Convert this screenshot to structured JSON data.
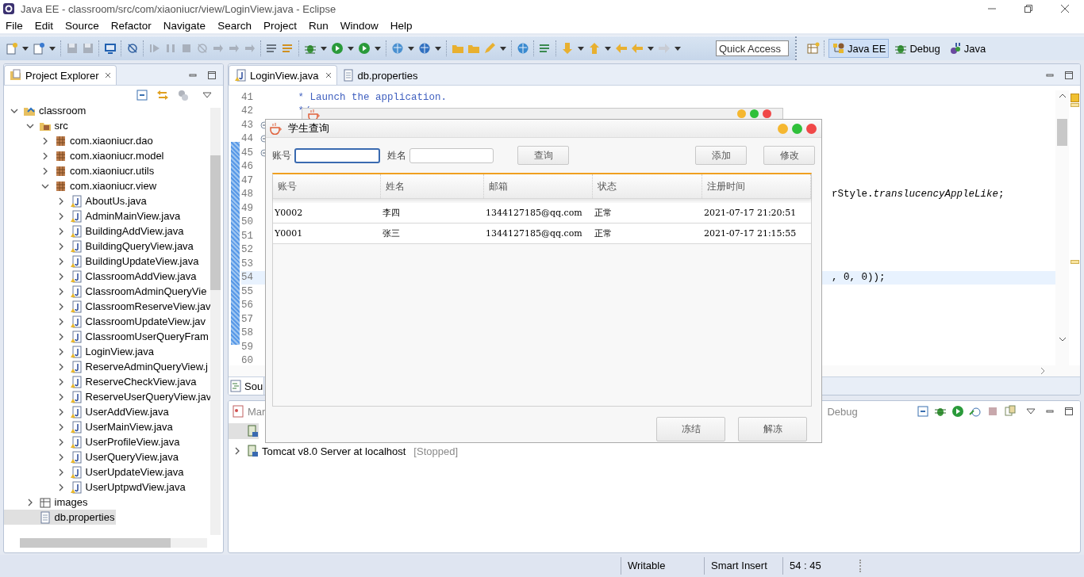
{
  "window": {
    "title": "Java EE - classroom/src/com/xiaoniucr/view/LoginView.java - Eclipse"
  },
  "menu": [
    "File",
    "Edit",
    "Source",
    "Refactor",
    "Navigate",
    "Search",
    "Project",
    "Run",
    "Window",
    "Help"
  ],
  "quick_access": {
    "placeholder": "Quick Access"
  },
  "perspectives": [
    {
      "label": "Java EE",
      "selected": true,
      "kind": "javaee"
    },
    {
      "label": "Debug",
      "selected": false,
      "kind": "debug"
    },
    {
      "label": "Java",
      "selected": false,
      "kind": "java"
    }
  ],
  "project_explorer": {
    "title": "Project Explorer",
    "tree": [
      {
        "label": "classroom",
        "kind": "project",
        "expanded": true,
        "selected": false,
        "children": [
          {
            "label": "src",
            "kind": "source",
            "expanded": true,
            "selected": false,
            "children": [
              {
                "label": "com.xiaoniucr.dao",
                "kind": "package",
                "expanded": false,
                "selected": false
              },
              {
                "label": "com.xiaoniucr.model",
                "kind": "package",
                "expanded": false,
                "selected": false
              },
              {
                "label": "com.xiaoniucr.utils",
                "kind": "package",
                "expanded": false,
                "selected": false
              },
              {
                "label": "com.xiaoniucr.view",
                "kind": "package",
                "expanded": true,
                "selected": false,
                "children": [
                  {
                    "label": "AboutUs.java",
                    "kind": "java",
                    "expanded": false,
                    "selected": false
                  },
                  {
                    "label": "AdminMainView.java",
                    "kind": "java",
                    "expanded": false,
                    "selected": false
                  },
                  {
                    "label": "BuildingAddView.java",
                    "kind": "java",
                    "expanded": false,
                    "selected": false
                  },
                  {
                    "label": "BuildingQueryView.java",
                    "kind": "java",
                    "expanded": false,
                    "selected": false
                  },
                  {
                    "label": "BuildingUpdateView.java",
                    "kind": "java",
                    "expanded": false,
                    "selected": false
                  },
                  {
                    "label": "ClassroomAddView.java",
                    "kind": "java",
                    "expanded": false,
                    "selected": false
                  },
                  {
                    "label": "ClassroomAdminQueryVie",
                    "kind": "java",
                    "expanded": false,
                    "selected": false
                  },
                  {
                    "label": "ClassroomReserveView.jav",
                    "kind": "java",
                    "expanded": false,
                    "selected": false
                  },
                  {
                    "label": "ClassroomUpdateView.jav",
                    "kind": "java",
                    "expanded": false,
                    "selected": false
                  },
                  {
                    "label": "ClassroomUserQueryFram",
                    "kind": "java",
                    "expanded": false,
                    "selected": false
                  },
                  {
                    "label": "LoginView.java",
                    "kind": "java",
                    "expanded": false,
                    "selected": false
                  },
                  {
                    "label": "ReserveAdminQueryView.j",
                    "kind": "java",
                    "expanded": false,
                    "selected": false
                  },
                  {
                    "label": "ReserveCheckView.java",
                    "kind": "java",
                    "expanded": false,
                    "selected": false
                  },
                  {
                    "label": "ReserveUserQueryView.jav",
                    "kind": "java",
                    "expanded": false,
                    "selected": false
                  },
                  {
                    "label": "UserAddView.java",
                    "kind": "java",
                    "expanded": false,
                    "selected": false
                  },
                  {
                    "label": "UserMainView.java",
                    "kind": "java",
                    "expanded": false,
                    "selected": false
                  },
                  {
                    "label": "UserProfileView.java",
                    "kind": "java",
                    "expanded": false,
                    "selected": false
                  },
                  {
                    "label": "UserQueryView.java",
                    "kind": "java",
                    "expanded": false,
                    "selected": false
                  },
                  {
                    "label": "UserUpdateView.java",
                    "kind": "java",
                    "expanded": false,
                    "selected": false
                  },
                  {
                    "label": "UserUptpwdView.java",
                    "kind": "java",
                    "expanded": false,
                    "selected": false
                  }
                ]
              }
            ]
          },
          {
            "label": "images",
            "kind": "folder",
            "expanded": false,
            "selected": false
          },
          {
            "label": "db.properties",
            "kind": "file",
            "selected": true
          }
        ]
      }
    ]
  },
  "editor": {
    "tabs": [
      {
        "label": "LoginView.java",
        "selected": true,
        "kind": "java"
      },
      {
        "label": "db.properties",
        "selected": false,
        "kind": "file"
      }
    ],
    "lines": [
      {
        "number": "41",
        "text": "     * Launch the application.",
        "kind": "comment",
        "current": false,
        "fold": false
      },
      {
        "number": "42",
        "text": "     */",
        "kind": "comment",
        "current": false,
        "fold": false
      },
      {
        "number": "43",
        "current": false,
        "fold": true
      },
      {
        "number": "44",
        "current": false,
        "fold": true
      },
      {
        "number": "45",
        "current": false,
        "fold": true
      },
      {
        "number": "46",
        "current": false,
        "fold": false
      },
      {
        "number": "47",
        "current": false,
        "fold": false
      },
      {
        "number": "48",
        "current": false,
        "fold": false,
        "tail": "rStyle.*translucencyAppleLike*;"
      },
      {
        "number": "49",
        "current": false,
        "fold": false
      },
      {
        "number": "50",
        "current": false,
        "fold": false
      },
      {
        "number": "51",
        "current": false,
        "fold": false
      },
      {
        "number": "52",
        "current": false,
        "fold": false
      },
      {
        "number": "53",
        "current": false,
        "fold": false
      },
      {
        "number": "54",
        "current": true,
        "fold": false,
        "tail": ", 0, 0));"
      },
      {
        "number": "55",
        "current": false,
        "fold": false
      },
      {
        "number": "56",
        "current": false,
        "fold": false
      },
      {
        "number": "57",
        "current": false,
        "fold": false
      },
      {
        "number": "58",
        "current": false,
        "fold": false
      },
      {
        "number": "59",
        "current": false,
        "fold": false
      },
      {
        "number": "60",
        "current": false,
        "fold": false
      }
    ],
    "bottom_tab": "Sou"
  },
  "bottom_panel": {
    "tabs": [
      {
        "label": "Mar",
        "kind": "markers"
      },
      {
        "label": "Debug",
        "kind": "debug"
      }
    ],
    "servers": [
      {
        "selected": true
      },
      {
        "name": "Tomcat v8.0 Server at localhost",
        "status": "[Stopped]",
        "selected": false,
        "expanded": false
      }
    ]
  },
  "dialog": {
    "title": "学生查询",
    "fields": [
      {
        "label": "账号",
        "focused": true
      },
      {
        "label": "姓名",
        "focused": false
      }
    ],
    "search_button": "查询",
    "actions": [
      "添加",
      "修改"
    ],
    "table": {
      "columns": [
        "账号",
        "姓名",
        "邮箱",
        "状态",
        "注册时间"
      ],
      "rows": [
        [
          "Y0002",
          "李四",
          "1344127185@qq.com",
          "正常",
          "2021-07-17 21:20:51"
        ],
        [
          "Y0001",
          "张三",
          "1344127185@qq.com",
          "正常",
          "2021-07-17 21:15:55"
        ]
      ]
    },
    "footer_buttons": [
      "冻结",
      "解冻"
    ]
  },
  "status_bar": [
    "Writable",
    "Smart Insert",
    "54 : 45"
  ]
}
